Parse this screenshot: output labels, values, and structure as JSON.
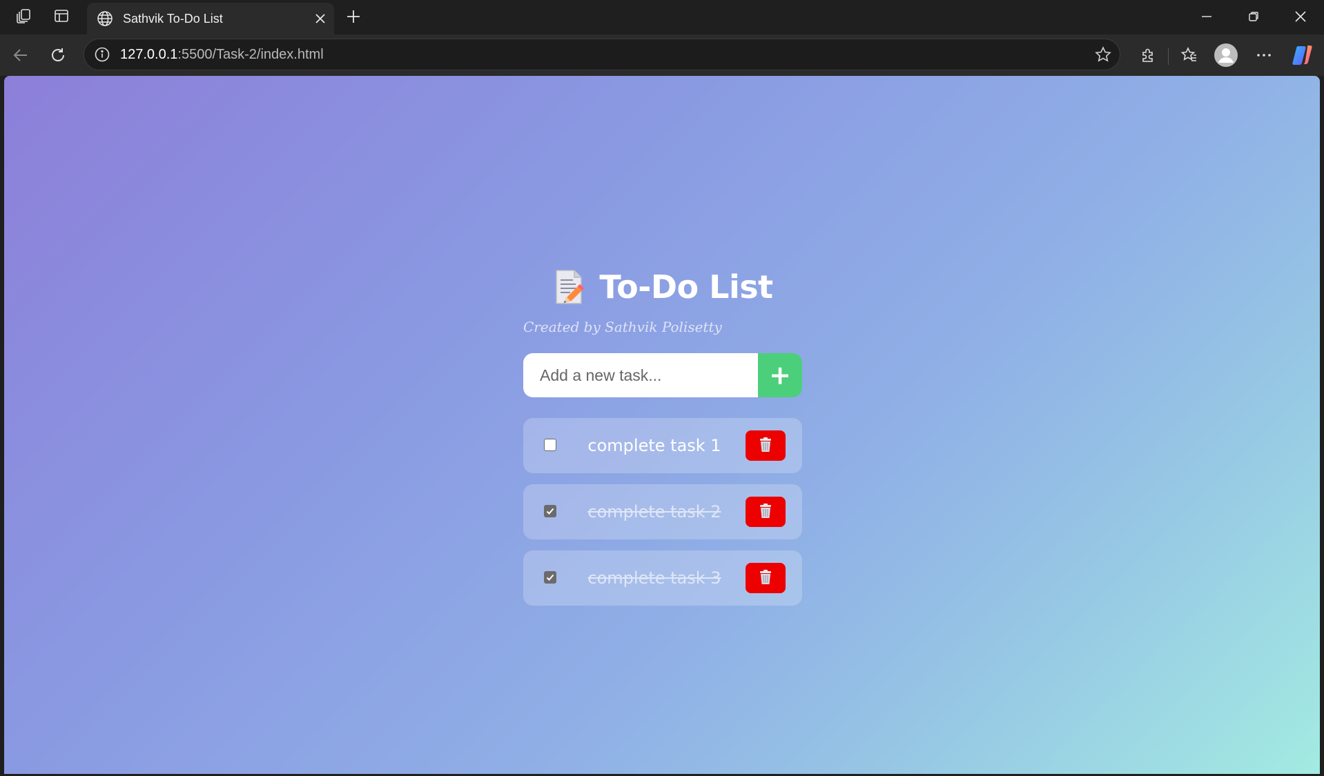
{
  "browser": {
    "tab_title": "Sathvik To-Do List",
    "url_host": "127.0.0.1",
    "url_rest": ":5500/Task-2/index.html",
    "icons": [
      "workspaces-icon",
      "tab-actions-icon",
      "globe-icon",
      "close-icon",
      "new-tab-icon",
      "minimize-icon",
      "restore-icon",
      "window-close-icon",
      "back-icon",
      "refresh-icon",
      "info-icon",
      "favorite-star-icon",
      "extensions-icon",
      "favorites-icon",
      "profile-icon",
      "more-icon",
      "copilot-icon"
    ]
  },
  "app": {
    "title": "To-Do List",
    "subtitle": "Created by Sathvik Polisetty",
    "input_placeholder": "Add a new task...",
    "add_label": "+",
    "tasks": [
      {
        "text": "complete task 1",
        "done": false
      },
      {
        "text": "complete task 2",
        "done": true
      },
      {
        "text": "complete task 3",
        "done": true
      }
    ],
    "colors": {
      "add_button": "#4ccf7a",
      "delete_button": "#ec0000",
      "gradient_start": "#8c7fd9",
      "gradient_end": "#a3ebe2"
    }
  }
}
